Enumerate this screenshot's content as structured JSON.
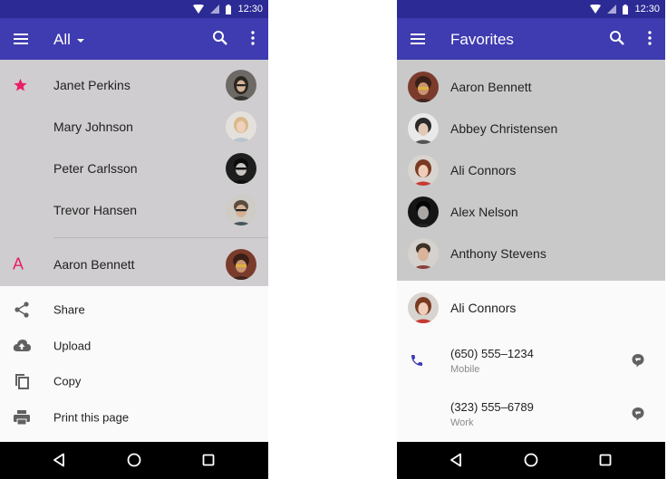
{
  "status_bar": {
    "time": "12:30"
  },
  "left_screen": {
    "app_bar": {
      "title": "All"
    },
    "favorites": [
      {
        "name": "Janet Perkins"
      },
      {
        "name": "Mary Johnson"
      },
      {
        "name": "Peter Carlsson"
      },
      {
        "name": "Trevor Hansen"
      }
    ],
    "section_letter": "A",
    "section_contacts": [
      {
        "name": "Aaron Bennett"
      }
    ],
    "bottom_sheet": [
      {
        "label": "Share",
        "icon": "share-icon"
      },
      {
        "label": "Upload",
        "icon": "upload-icon"
      },
      {
        "label": "Copy",
        "icon": "copy-icon"
      },
      {
        "label": "Print this page",
        "icon": "print-icon"
      }
    ]
  },
  "right_screen": {
    "app_bar": {
      "title": "Favorites"
    },
    "favorites": [
      {
        "name": "Aaron Bennett"
      },
      {
        "name": "Abbey Christensen"
      },
      {
        "name": "Ali Connors"
      },
      {
        "name": "Alex Nelson"
      },
      {
        "name": "Anthony Stevens"
      }
    ],
    "detail": {
      "name": "Ali Connors",
      "phones": [
        {
          "number": "(650) 555–1234",
          "type": "Mobile"
        },
        {
          "number": "(323) 555–6789",
          "type": "Work"
        }
      ]
    }
  },
  "colors": {
    "status_bar": "#2c2a94",
    "app_bar": "#3f3bb0",
    "accent": "#e91e63",
    "phone_icon": "#3f3bb0",
    "scrim_left": "#cfcdcf",
    "scrim_right": "#c9c9c9"
  }
}
